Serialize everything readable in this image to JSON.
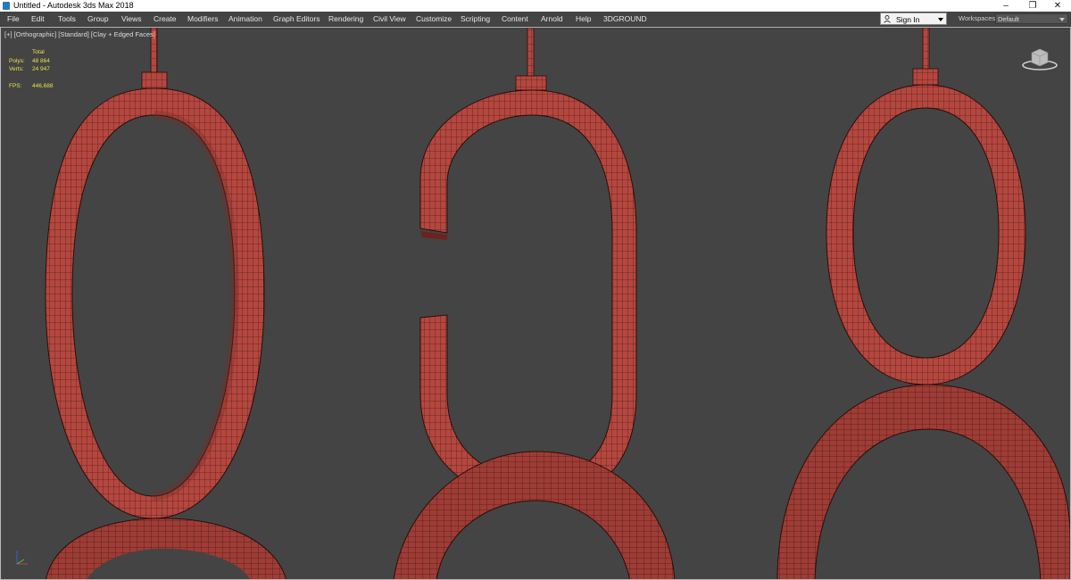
{
  "window": {
    "title": "Untitled - Autodesk 3ds Max 2018",
    "minimize_glyph": "–",
    "restore_glyph": "❐",
    "close_glyph": "✕"
  },
  "menu": {
    "items": [
      "File",
      "Edit",
      "Tools",
      "Group",
      "Views",
      "Create",
      "Modifiers",
      "Animation",
      "Graph Editors",
      "Rendering",
      "Civil View",
      "Customize",
      "Scripting",
      "Content",
      "Arnold",
      "Help",
      "3DGROUND"
    ]
  },
  "account": {
    "sign_in_label": "Sign In"
  },
  "workspaces": {
    "label": "Workspaces:",
    "value": "Default"
  },
  "viewport": {
    "label": "[+] [Orthographic] [Standard] [Clay + Edged Faces]",
    "stats": {
      "header": "Total",
      "polys_label": "Polys:",
      "polys_value": "48 864",
      "verts_label": "Verts:",
      "verts_value": "24 947",
      "fps_label": "FPS:",
      "fps_value": "446,688"
    }
  },
  "colors": {
    "background": "#444444",
    "clay": "#b4473f",
    "clay_dark": "#7a2a25",
    "wire": "#2a0d0a",
    "stats_text": "#e6e24a"
  },
  "icons": [
    "app-icon",
    "user-icon",
    "viewcube-icon",
    "axis-tripod-icon"
  ]
}
